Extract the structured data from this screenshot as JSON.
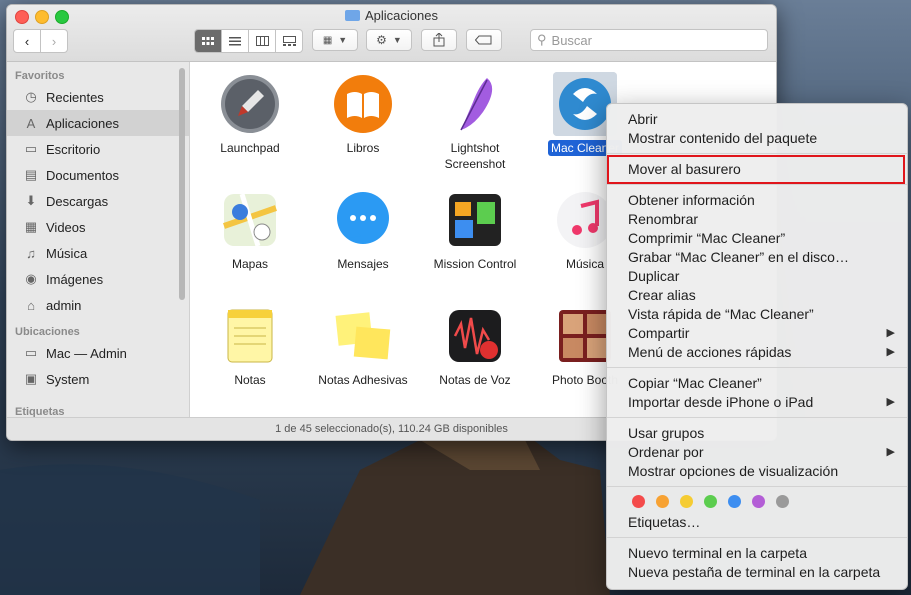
{
  "window": {
    "title": "Aplicaciones"
  },
  "toolbar": {
    "search_placeholder": "Buscar"
  },
  "sidebar": {
    "sections": [
      {
        "title": "Favoritos",
        "items": [
          {
            "label": "Recientes",
            "icon": "clock-icon",
            "selected": false
          },
          {
            "label": "Aplicaciones",
            "icon": "apps-icon",
            "selected": true
          },
          {
            "label": "Escritorio",
            "icon": "desktop-icon",
            "selected": false
          },
          {
            "label": "Documentos",
            "icon": "document-icon",
            "selected": false
          },
          {
            "label": "Descargas",
            "icon": "download-icon",
            "selected": false
          },
          {
            "label": "Videos",
            "icon": "film-icon",
            "selected": false
          },
          {
            "label": "Música",
            "icon": "music-icon",
            "selected": false
          },
          {
            "label": "Imágenes",
            "icon": "camera-icon",
            "selected": false
          },
          {
            "label": "admin",
            "icon": "home-icon",
            "selected": false
          }
        ]
      },
      {
        "title": "Ubicaciones",
        "items": [
          {
            "label": "Mac — Admin",
            "icon": "computer-icon",
            "selected": false
          },
          {
            "label": "System",
            "icon": "disk-icon",
            "selected": false
          }
        ]
      },
      {
        "title": "Etiquetas",
        "items": []
      }
    ]
  },
  "apps": [
    {
      "label": "Launchpad",
      "icon": "rocket-icon"
    },
    {
      "label": "Libros",
      "icon": "book-icon"
    },
    {
      "label": "Lightshot Screenshot",
      "icon": "feather-icon"
    },
    {
      "label": "Mac Cleaner",
      "icon": "mac-cleaner-icon",
      "selected": true
    },
    {
      "label": "Mapas",
      "icon": "maps-icon"
    },
    {
      "label": "Mensajes",
      "icon": "messages-icon"
    },
    {
      "label": "Mission Control",
      "icon": "mission-control-icon"
    },
    {
      "label": "Música",
      "icon": "music-note-icon"
    },
    {
      "label": "Notas",
      "icon": "notes-icon"
    },
    {
      "label": "Notas Adhesivas",
      "icon": "stickies-icon"
    },
    {
      "label": "Notas de Voz",
      "icon": "voice-memos-icon"
    },
    {
      "label": "Photo Booth",
      "icon": "photo-booth-icon"
    }
  ],
  "status": "1 de 45 seleccionado(s), 110.24 GB disponibles",
  "context_menu": {
    "groups": [
      [
        {
          "label": "Abrir"
        },
        {
          "label": "Mostrar contenido del paquete"
        }
      ],
      [
        {
          "label": "Mover al basurero",
          "highlighted": true
        }
      ],
      [
        {
          "label": "Obtener información"
        },
        {
          "label": "Renombrar"
        },
        {
          "label": "Comprimir “Mac Cleaner”"
        },
        {
          "label": "Grabar “Mac Cleaner” en el disco…"
        },
        {
          "label": "Duplicar"
        },
        {
          "label": "Crear alias"
        },
        {
          "label": "Vista rápida de “Mac Cleaner”"
        },
        {
          "label": "Compartir",
          "submenu": true
        },
        {
          "label": "Menú de acciones rápidas",
          "submenu": true
        }
      ],
      [
        {
          "label": "Copiar “Mac Cleaner”"
        },
        {
          "label": "Importar desde iPhone o iPad",
          "submenu": true
        }
      ],
      [
        {
          "label": "Usar grupos"
        },
        {
          "label": "Ordenar por",
          "submenu": true
        },
        {
          "label": "Mostrar opciones de visualización"
        }
      ],
      [
        {
          "label": "Etiquetas…"
        }
      ],
      [
        {
          "label": "Nuevo terminal en la carpeta"
        },
        {
          "label": "Nueva pestaña de terminal en la carpeta"
        }
      ]
    ],
    "tag_colors": [
      "#f44b4b",
      "#f7a233",
      "#f5cc33",
      "#5ccd4f",
      "#3d8ef0",
      "#b35ed6",
      "#9a9a9a"
    ]
  }
}
